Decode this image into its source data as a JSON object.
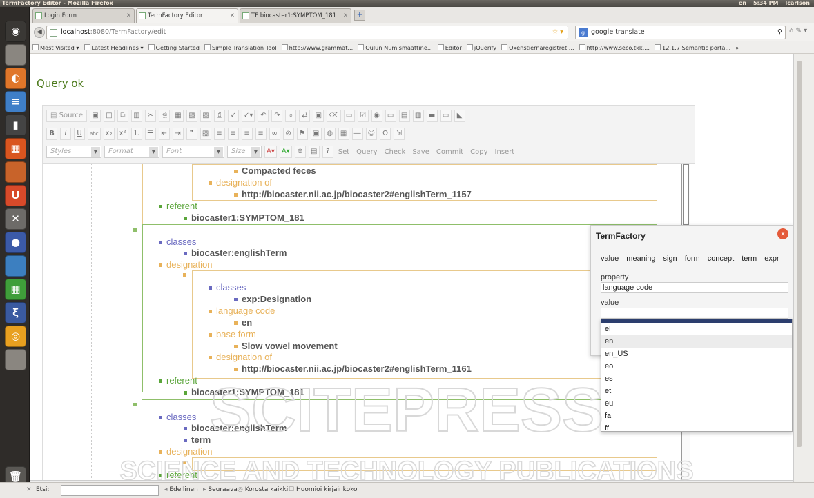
{
  "window": {
    "title": "TermFactory Editor - Mozilla Firefox",
    "tray": [
      "en",
      "5:34 PM",
      "lcarlson"
    ]
  },
  "tabs": [
    {
      "label": "Login Form"
    },
    {
      "label": "TermFactory Editor"
    },
    {
      "label": "TF biocaster1:SYMPTOM_181"
    }
  ],
  "url": {
    "host": "localhost",
    "path": ":8080/TermFactory/edit"
  },
  "search": {
    "value": "google translate"
  },
  "bookmarks": [
    "Most Visited ▾",
    "Latest Headlines ▾",
    "Getting Started",
    "Simple Translation Tool",
    "http://www.grammat...",
    "Oulun Numismaattine...",
    "Editor",
    "jQuerify",
    "Oxenstiernaregistret ...",
    "http://www.seco.tkk....",
    "12.1.7 Semantic porta...",
    "»"
  ],
  "status": "Query ok",
  "toolbar": {
    "source": "Source",
    "styles": "Styles",
    "format": "Format",
    "font": "Font",
    "size": "Size",
    "commands": [
      "Set",
      "Query",
      "Check",
      "Save",
      "Commit",
      "Copy",
      "Insert"
    ]
  },
  "doc": {
    "i1": "Compacted feces",
    "i2": "designation of",
    "i3": "http://biocaster.nii.ac.jp/biocaster2#englishTerm_1157",
    "i4": "referent",
    "i5": "biocaster1:SYMPTOM_181",
    "i6": "classes",
    "i7": "biocaster:englishTerm",
    "i8": "designation",
    "i9": "classes",
    "i10": "exp:Designation",
    "i11": "language code",
    "i12": "en",
    "i13": "base form",
    "i14": "Slow vowel movement",
    "i15": "designation of",
    "i16": "http://biocaster.nii.ac.jp/biocaster2#englishTerm_1161",
    "i17": "referent",
    "i18": "biocaster1:SYMPTOM_181",
    "i19": "classes",
    "i20": "biocaster:englishTerm",
    "i21": "term",
    "i22": "designation",
    "i23": "referent"
  },
  "popup": {
    "title": "TermFactory",
    "tabs": [
      "value",
      "meaning",
      "sign",
      "form",
      "concept",
      "term",
      "expr"
    ],
    "property_label": "property",
    "property_value": "language code",
    "value_label": "value",
    "value_value": ""
  },
  "languages": [
    "el",
    "en",
    "en_US",
    "eo",
    "es",
    "et",
    "eu",
    "fa",
    "ff"
  ],
  "findbar": {
    "label": "Etsi:",
    "prev": "Edellinen",
    "next": "Seuraava",
    "highlight": "Korosta kaikki",
    "match_case": "Huomioi kirjainkoko"
  },
  "watermark": {
    "line1": "SCITEPRESS",
    "line2": "SCIENCE AND TECHNOLOGY PUBLICATIONS"
  }
}
